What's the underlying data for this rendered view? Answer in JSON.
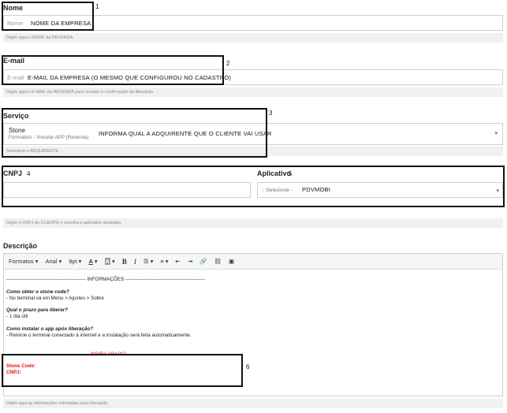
{
  "nome": {
    "label": "Nome",
    "placeholder": "Nome",
    "value": "NOME DA EMPRESA",
    "help": "Digite aqui o NOME da REVENDA.",
    "annotation": "1"
  },
  "email": {
    "label": "E-mail",
    "placeholder": "E-mail",
    "value": "E-MAIL DA EMPRESA (O MESMO QUE CONFIGUROU NO CADASTRO)",
    "help": "Digite aqui o E-MAIL da REVENDA para receber a confirmação da liberação.",
    "annotation": "2"
  },
  "servico": {
    "label": "Serviço",
    "selected_title": "Stone",
    "selected_subtitle": "Formulário - Vincular APP (Revenda)",
    "note": "INFORMA QUAL A ADQUIRENTE QUE O CLIENTE VAI USAR",
    "help": "Selecione a ADQUIRENTE.",
    "annotation": "3"
  },
  "cnpj": {
    "label": "CNPJ",
    "annotation": "4",
    "value": ""
  },
  "aplicativo": {
    "label": "Aplicativo",
    "annotation": "5",
    "placeholder": "- Selecione -",
    "value": "PDVMOBI"
  },
  "cnpj_app_help": "Digite o CNPJ do CLIENTE e escolha o aplicativo desejado.",
  "descricao": {
    "label": "Descrição",
    "toolbar": {
      "formats": "Formatos",
      "font": "Arial",
      "size": "9pt"
    },
    "content": {
      "header": "------------------------------------------------ INFORMAÇÕES ------------------------------------------------",
      "q1": "Como obter o stone code?",
      "a1": "- No terminal vá em Menu > Ajustes > Sobre",
      "q2": "Qual o prazo para liberar?",
      "a2": "- 1 dia útil",
      "q3": "Como instalar o app após liberação?",
      "a3": "- Reinicie o terminal conectado à internet e a instalação será feita automaticamente.",
      "insert_line": "--------------------------------------------------          INSIRA ABAIXO          --------------------------------------------------",
      "stone_code": "Stone Code:",
      "cnpj": "CNPJ:"
    },
    "help": "Digite aqui as informações solicitadas para liberação.",
    "annotation": "6"
  },
  "colors": {
    "border": "#cfcfcf",
    "help_bg": "#f0f0f0",
    "annotation_box": "#111111",
    "red_text": "#e01010"
  }
}
